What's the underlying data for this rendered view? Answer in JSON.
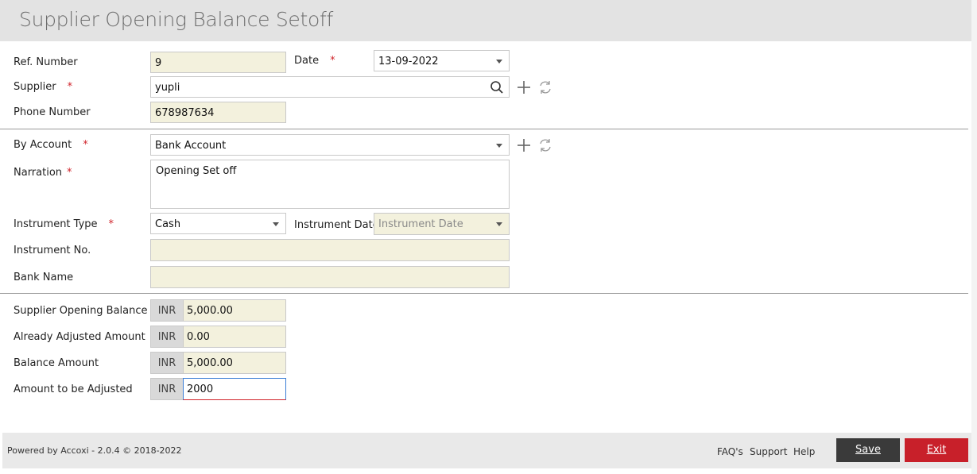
{
  "page": {
    "title": "Supplier Opening Balance Setoff"
  },
  "form": {
    "ref_number_label": "Ref. Number",
    "ref_number_value": "9",
    "date_label": "Date",
    "date_value": "13-09-2022",
    "supplier_label": "Supplier",
    "supplier_value": "yupli",
    "phone_label": "Phone Number",
    "phone_value": "678987634",
    "by_account_label": "By Account",
    "by_account_value": "Bank Account",
    "narration_label": "Narration",
    "narration_value": "Opening Set off",
    "instrument_type_label": "Instrument Type",
    "instrument_type_value": "Cash",
    "instrument_date_label": "Instrument Date",
    "instrument_date_placeholder": "Instrument Date",
    "instrument_no_label": "Instrument No.",
    "instrument_no_value": "",
    "bank_name_label": "Bank Name",
    "bank_name_value": "",
    "required_mark": "*"
  },
  "amounts": {
    "currency": "INR",
    "opening_label": "Supplier Opening Balance",
    "opening_value": "5,000.00",
    "adjusted_label": "Already Adjusted Amount",
    "adjusted_value": "0.00",
    "balance_label": "Balance Amount",
    "balance_value": "5,000.00",
    "to_adjust_label": "Amount to be Adjusted",
    "to_adjust_value": "2000"
  },
  "footer": {
    "powered": "Powered by Accoxi - 2.0.4 © 2018-2022",
    "faq": "FAQ's",
    "support": "Support",
    "help": "Help",
    "save": "Save",
    "exit": "Exit"
  },
  "colors": {
    "required": "#d0242b",
    "field_bg": "#f3f1dd",
    "save_bg": "#3a3a3a",
    "exit_bg": "#c8202a"
  }
}
